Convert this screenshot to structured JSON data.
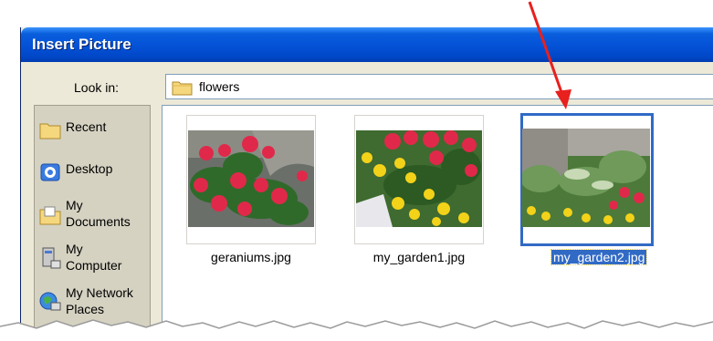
{
  "dialog": {
    "title": "Insert Picture"
  },
  "look_in": {
    "label": "Look in:",
    "value": "flowers"
  },
  "places": [
    {
      "label": "Recent",
      "icon": "recent-folder-icon"
    },
    {
      "label": "Desktop",
      "icon": "desktop-icon"
    },
    {
      "label": "My\nDocuments",
      "icon": "my-documents-icon"
    },
    {
      "label": "My\nComputer",
      "icon": "my-computer-icon"
    },
    {
      "label": "My Network\nPlaces",
      "icon": "network-places-icon"
    }
  ],
  "files": [
    {
      "name": "geraniums.jpg",
      "selected": false
    },
    {
      "name": "my_garden1.jpg",
      "selected": false
    },
    {
      "name": "my_garden2.jpg",
      "selected": true
    }
  ],
  "colors": {
    "title_bar": "#0553d8",
    "selection": "#316ac5",
    "annotation_arrow": "#e8201e"
  }
}
